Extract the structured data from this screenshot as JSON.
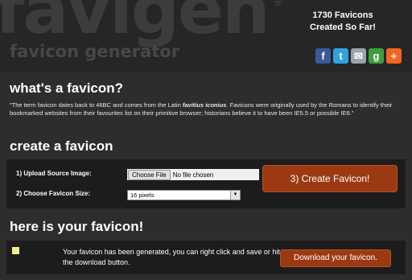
{
  "header": {
    "logo_text": "favigen",
    "logo_star": "*",
    "tagline": "favicon generator",
    "counter_line1": "1730 Favicons",
    "counter_line2": "Created So Far!",
    "social": [
      {
        "name": "facebook-icon",
        "glyph": "f"
      },
      {
        "name": "twitter-icon",
        "glyph": "t"
      },
      {
        "name": "email-icon",
        "glyph": "✉"
      },
      {
        "name": "google-icon",
        "glyph": "g"
      },
      {
        "name": "addthis-icon",
        "glyph": "+"
      }
    ]
  },
  "about": {
    "title": "what's a favicon?",
    "text_before": "\"The term favicon dates back to 46BC and comes from the Latin ",
    "text_italic": "favitius iconius",
    "text_after": ". Favicons were originally used by the Romans to identify their bookmarked websites from their favourites list on their primitive browser; historians believe it to have been IE5.5 or possible IE6.\""
  },
  "create": {
    "title": "create a favicon",
    "upload_label": "1) Upload Source Image:",
    "file_button": "Choose File",
    "file_status": "No file chosen",
    "size_label": "2) Choose Favicon Size:",
    "size_value": "16 pixels",
    "submit_label": "3) Create Favicon!"
  },
  "result": {
    "title": "here is your favicon!",
    "message": "Your favicon has been generated, you can right click and save or hit the download button.",
    "download_label": "Download your favicon."
  }
}
